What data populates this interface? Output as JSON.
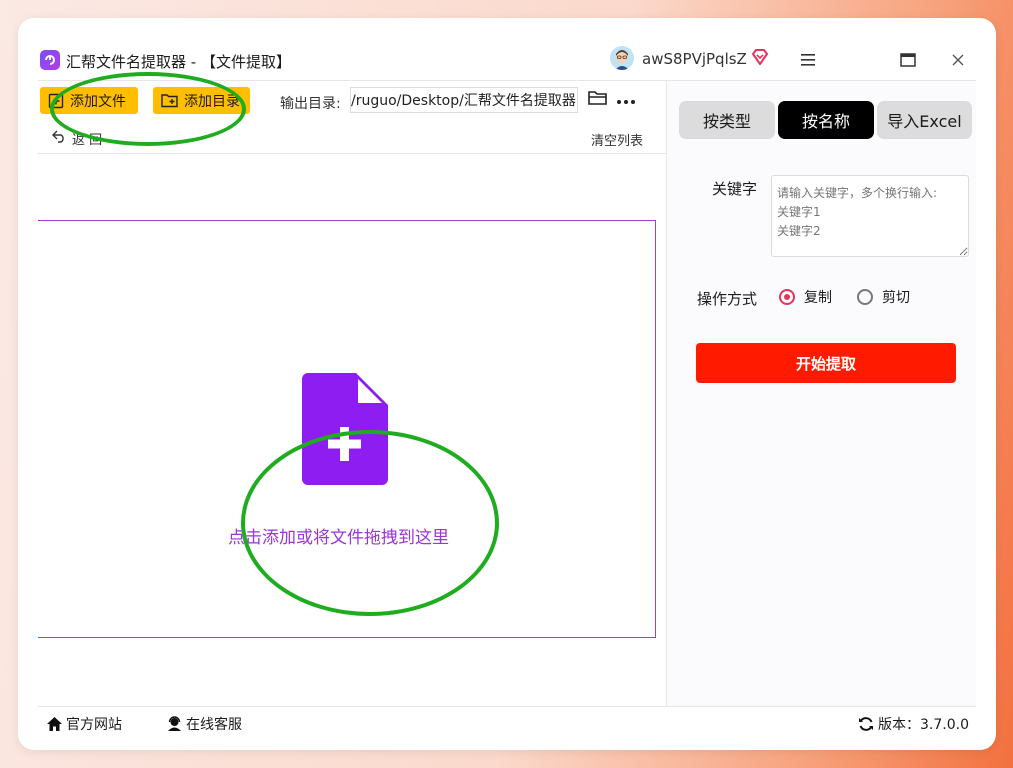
{
  "window": {
    "title": "汇帮文件名提取器 - 【文件提取】",
    "user": {
      "name": "awS8PVjPqlsZ"
    },
    "controls": {
      "menu": "menu-icon",
      "maximize": "maximize-icon",
      "close": "close-icon"
    }
  },
  "toolbar": {
    "add_file_label": "添加文件",
    "add_dir_label": "添加目录",
    "output_label": "输出目录:",
    "output_path": "/ruguo/Desktop/汇帮文件名提取器",
    "back_label": "返 回",
    "clear_list_label": "清空列表"
  },
  "dropzone": {
    "hint": "点击添加或将文件拖拽到这里"
  },
  "right_panel": {
    "tabs": [
      {
        "label": "按类型",
        "active": false
      },
      {
        "label": "按名称",
        "active": true
      },
      {
        "label": "导入Excel",
        "active": false
      }
    ],
    "keyword_label": "关键字",
    "keyword_placeholder": "请输入关键字，多个换行输入:\n关键字1\n关键字2",
    "operation_label": "操作方式",
    "operations": [
      {
        "label": "复制",
        "checked": true
      },
      {
        "label": "剪切",
        "checked": false
      }
    ],
    "start_label": "开始提取"
  },
  "footer": {
    "website_label": "官方网站",
    "support_label": "在线客服",
    "version_label": "版本：3.7.0.0"
  },
  "colors": {
    "accent_yellow": "#ffbf00",
    "primary_red": "#ff1a00",
    "purple": "#9a35d8",
    "annotation_green": "#1fac1f"
  }
}
